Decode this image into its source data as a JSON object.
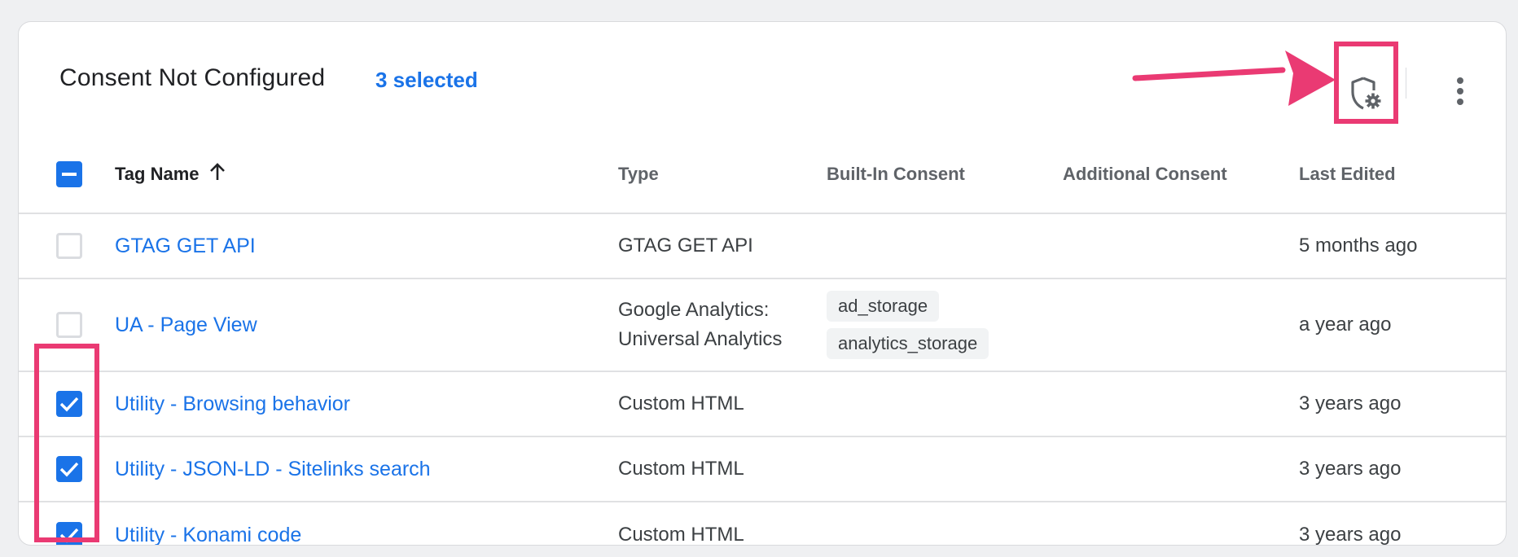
{
  "header": {
    "title": "Consent Not Configured",
    "selected_count": "3 selected"
  },
  "toolbar": {
    "consent_icon": "shield-gear-icon",
    "more_icon": "more-vert-icon"
  },
  "colors": {
    "accent": "#1a73e8",
    "highlight": "#ea3a73"
  },
  "table": {
    "columns": {
      "name": "Tag Name",
      "type": "Type",
      "built_in": "Built-In Consent",
      "additional": "Additional Consent",
      "last_edited": "Last Edited"
    },
    "sort": "ascending",
    "header_checkbox": "indeterminate",
    "rows": [
      {
        "name": "GTAG GET API",
        "type": [
          "GTAG GET API"
        ],
        "built_in": [],
        "additional": "",
        "last_edited": "5 months ago",
        "checked": false
      },
      {
        "name": "UA - Page View",
        "type": [
          "Google Analytics:",
          "Universal Analytics"
        ],
        "built_in": [
          "ad_storage",
          "analytics_storage"
        ],
        "additional": "",
        "last_edited": "a year ago",
        "checked": false
      },
      {
        "name": "Utility - Browsing behavior",
        "type": [
          "Custom HTML"
        ],
        "built_in": [],
        "additional": "",
        "last_edited": "3 years ago",
        "checked": true
      },
      {
        "name": "Utility - JSON-LD - Sitelinks search",
        "type": [
          "Custom HTML"
        ],
        "built_in": [],
        "additional": "",
        "last_edited": "3 years ago",
        "checked": true
      },
      {
        "name": "Utility - Konami code",
        "type": [
          "Custom HTML"
        ],
        "built_in": [],
        "additional": "",
        "last_edited": "3 years ago",
        "checked": true
      }
    ]
  }
}
